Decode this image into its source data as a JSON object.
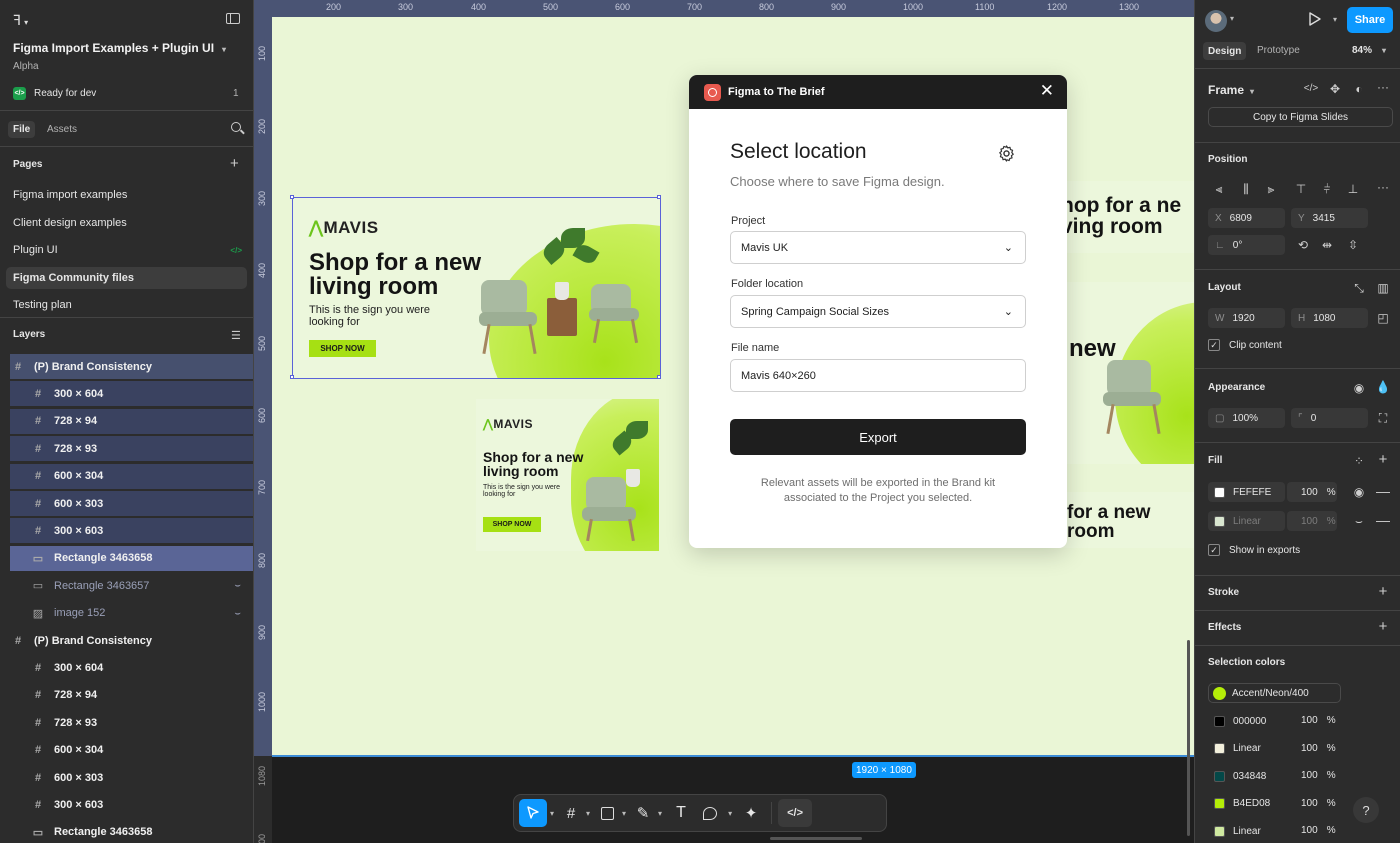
{
  "app": {
    "file_title": "Figma Import Examples + Plugin UI",
    "team": "Alpha",
    "ready_for_dev": "Ready for dev",
    "ready_count": "1",
    "tabs": [
      "File",
      "Assets"
    ],
    "pages_label": "Pages",
    "pages": [
      {
        "label": "Figma import examples",
        "active": false
      },
      {
        "label": "Client design examples",
        "active": false
      },
      {
        "label": "Plugin UI",
        "active": false
      },
      {
        "label": "Figma Community files",
        "active": true
      },
      {
        "label": "Testing plan",
        "active": false
      }
    ],
    "layers_label": "Layers",
    "layers": [
      {
        "label": "(P) Brand Consistency",
        "icon": "#",
        "level": 0,
        "state": "sel"
      },
      {
        "label": "300 × 604",
        "icon": "#",
        "level": 1,
        "state": "selchild"
      },
      {
        "label": "728 × 94",
        "icon": "#",
        "level": 1,
        "state": "selchild"
      },
      {
        "label": "728 × 93",
        "icon": "#",
        "level": 1,
        "state": "selchild"
      },
      {
        "label": "600 × 304",
        "icon": "#",
        "level": 1,
        "state": "selchild"
      },
      {
        "label": "600 × 303",
        "icon": "#",
        "level": 1,
        "state": "selchild"
      },
      {
        "label": "300 × 603",
        "icon": "#",
        "level": 1,
        "state": "selchild"
      },
      {
        "label": "Rectangle 3463658",
        "icon": "▭",
        "level": 1,
        "state": "hl"
      },
      {
        "label": "Rectangle 3463657",
        "icon": "▭",
        "level": 1,
        "state": "dim"
      },
      {
        "label": "image 152",
        "icon": "▨",
        "level": 1,
        "state": "dim"
      },
      {
        "label": "(P) Brand Consistency",
        "icon": "#",
        "level": 0,
        "state": ""
      },
      {
        "label": "300 × 604",
        "icon": "#",
        "level": 1,
        "state": ""
      },
      {
        "label": "728 × 94",
        "icon": "#",
        "level": 1,
        "state": ""
      },
      {
        "label": "728 × 93",
        "icon": "#",
        "level": 1,
        "state": ""
      },
      {
        "label": "600 × 304",
        "icon": "#",
        "level": 1,
        "state": ""
      },
      {
        "label": "600 × 303",
        "icon": "#",
        "level": 1,
        "state": ""
      },
      {
        "label": "300 × 603",
        "icon": "#",
        "level": 1,
        "state": ""
      },
      {
        "label": "Rectangle 3463658",
        "icon": "▭",
        "level": 1,
        "state": ""
      }
    ]
  },
  "rulers": {
    "top": [
      "200",
      "300",
      "400",
      "500",
      "600",
      "700",
      "800",
      "900",
      "1000",
      "1100",
      "1200",
      "1300"
    ],
    "left": [
      "100",
      "200",
      "300",
      "400",
      "500",
      "600",
      "700",
      "800",
      "900",
      "1000",
      "1080",
      "00"
    ]
  },
  "canvas": {
    "frame_size_badge": "1920 × 1080",
    "ad": {
      "brand": "MAVIS",
      "headline_line1": "Shop for a new",
      "headline_line2": "living room",
      "sub_line1": "This is the sign you were",
      "sub_line2": "looking for",
      "cta": "SHOP NOW",
      "right_line1": "hop for a ne",
      "right_line2": "ving room",
      "right_mid": "new",
      "right_low1": "for a new",
      "right_low2": "room"
    }
  },
  "dialog": {
    "title": "Figma to The Brief",
    "heading": "Select location",
    "subheading": "Choose where to save Figma design.",
    "project_label": "Project",
    "project_value": "Mavis UK",
    "folder_label": "Folder location",
    "folder_value": "Spring Campaign Social Sizes",
    "filename_label": "File name",
    "filename_value": "Mavis 640×260",
    "export_button": "Export",
    "note_line1": "Relevant assets will be exported in the Brand kit",
    "note_line2": "associated to the Project you selected."
  },
  "right_panel": {
    "share": "Share",
    "tabs": [
      "Design",
      "Prototype"
    ],
    "zoom": "84%",
    "frame_label": "Frame",
    "copy_slides": "Copy to Figma Slides",
    "position_label": "Position",
    "x": "6809",
    "y": "3415",
    "rotation": "0°",
    "layout_label": "Layout",
    "w": "1920",
    "h": "1080",
    "clip_content": "Clip content",
    "appearance_label": "Appearance",
    "opacity": "100%",
    "radius": "0",
    "fill_label": "Fill",
    "fills": [
      {
        "name": "FEFEFE",
        "pct": "100",
        "color": "#fefefe",
        "dim": false
      },
      {
        "name": "Linear",
        "pct": "100",
        "color": "#d9e6d0",
        "dim": true
      }
    ],
    "show_in_exports": "Show in exports",
    "stroke_label": "Stroke",
    "effects_label": "Effects",
    "selection_colors_label": "Selection colors",
    "accent_color": {
      "name": "Accent/Neon/400",
      "color": "#b4ed08"
    },
    "selection_colors": [
      {
        "name": "000000",
        "pct": "100",
        "color": "#000000"
      },
      {
        "name": "Linear",
        "pct": "100",
        "color": "#f3f0dc"
      },
      {
        "name": "034848",
        "pct": "100",
        "color": "#034848"
      },
      {
        "name": "B4ED08",
        "pct": "100",
        "color": "#b4ed08"
      },
      {
        "name": "Linear",
        "pct": "100",
        "color": "#cfe9a0"
      }
    ],
    "percent_sign": "%",
    "help": "?"
  },
  "colors": {
    "accent": "#0d99ff",
    "canvas_bg": "#eaf6d6",
    "selection": "#46506e",
    "brand_green": "#a6e013"
  }
}
